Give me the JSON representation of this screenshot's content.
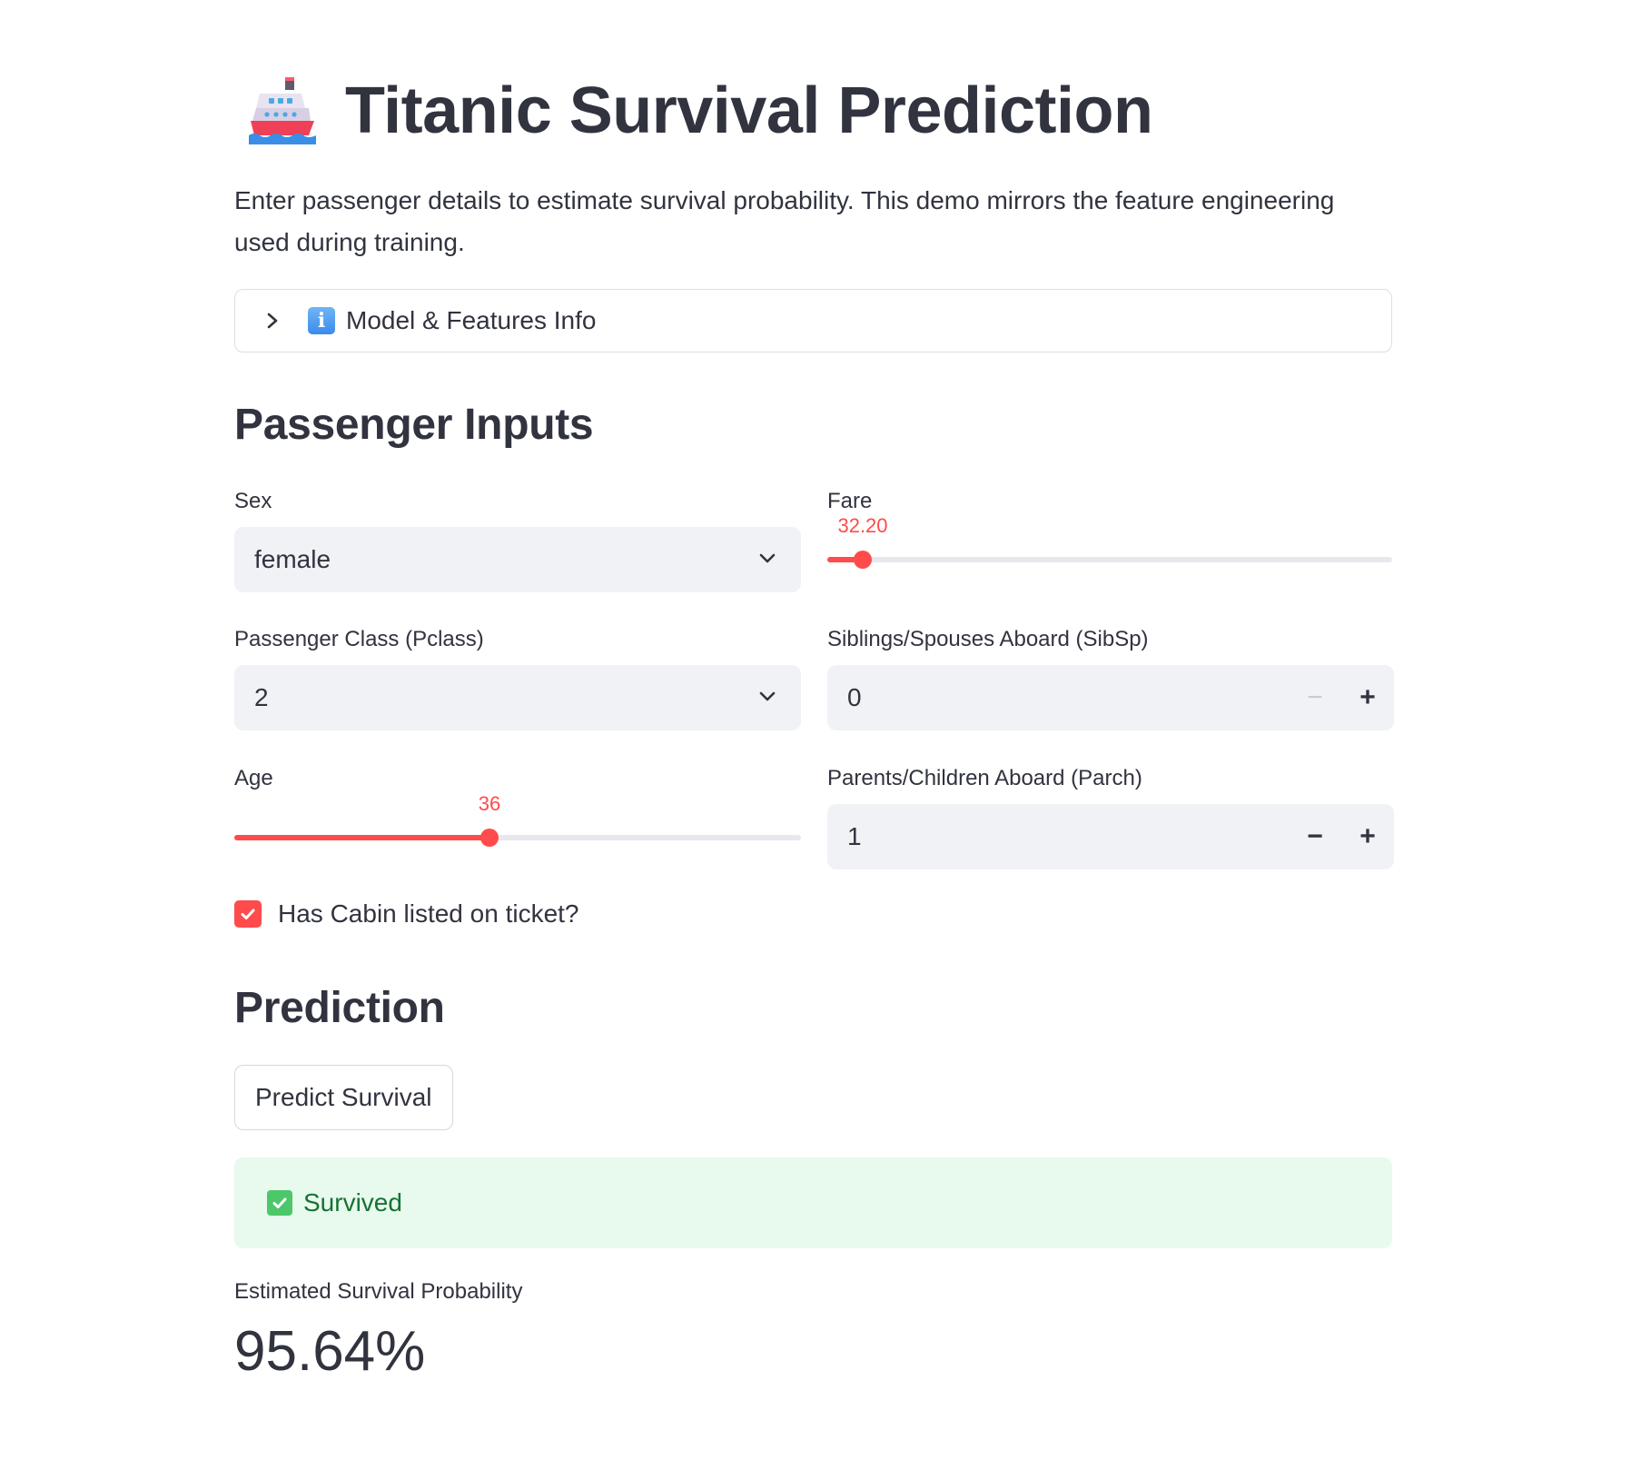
{
  "header": {
    "title": "Titanic Survival Prediction",
    "icon": "ship-icon",
    "description": "Enter passenger details to estimate survival probability. This demo mirrors the feature engineering used during training."
  },
  "expander": {
    "label": "Model & Features Info",
    "icon": "information-icon",
    "expanded": false
  },
  "inputs": {
    "heading": "Passenger Inputs",
    "sex": {
      "label": "Sex",
      "value": "female"
    },
    "pclass": {
      "label": "Passenger Class (Pclass)",
      "value": "2"
    },
    "age": {
      "label": "Age",
      "value": "36",
      "fraction": 0.45
    },
    "fare": {
      "label": "Fare",
      "value": "32.20",
      "fraction": 0.063
    },
    "sibsp": {
      "label": "Siblings/Spouses Aboard (SibSp)",
      "value": "0",
      "minus": "−",
      "plus": "+"
    },
    "parch": {
      "label": "Parents/Children Aboard (Parch)",
      "value": "1",
      "minus": "−",
      "plus": "+"
    },
    "has_cabin": {
      "label": "Has Cabin listed on ticket?",
      "checked": true
    }
  },
  "prediction": {
    "heading": "Prediction",
    "button_label": "Predict Survival",
    "result_text": "Survived",
    "metric_label": "Estimated Survival Probability",
    "metric_value": "95.64%"
  },
  "colors": {
    "accent": "#ff4b4b",
    "success_bg": "#e8f9ee",
    "success_text": "#177233",
    "input_bg": "#f0f2f6"
  }
}
